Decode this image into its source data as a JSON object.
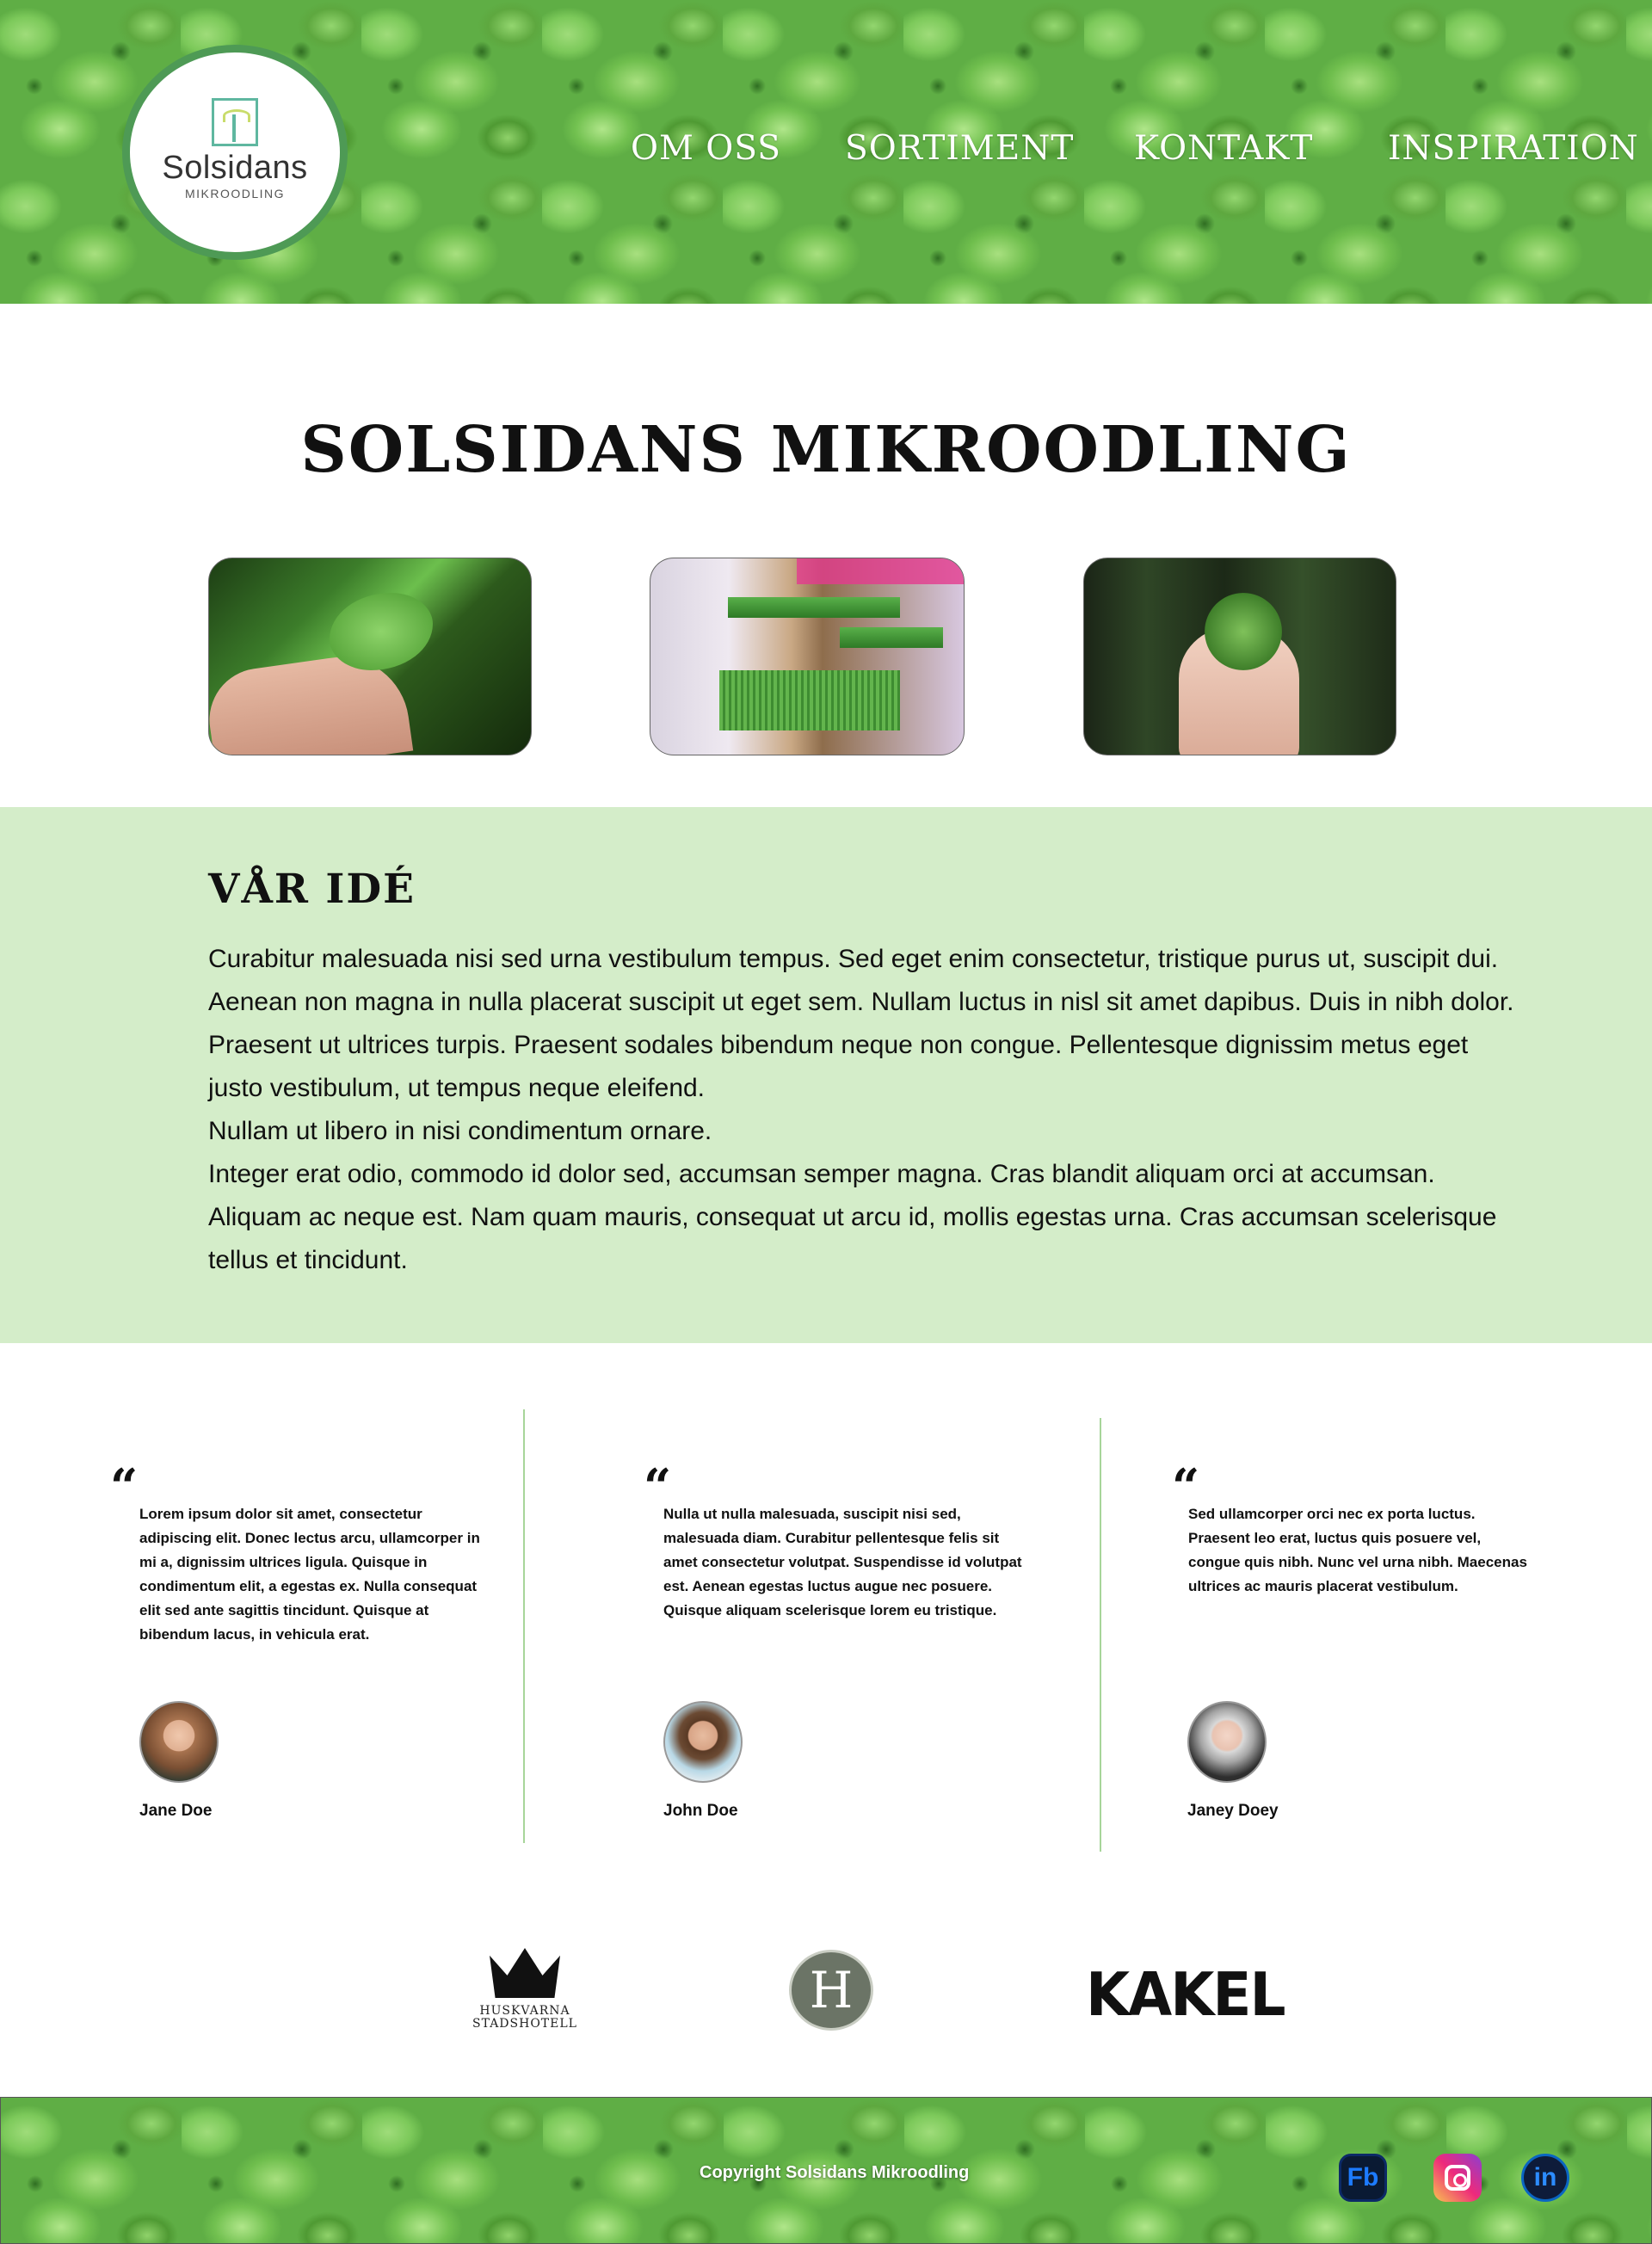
{
  "header": {
    "logo": {
      "name": "Solsidans",
      "sub": "MIKROODLING"
    },
    "nav": [
      {
        "label": "OM OSS"
      },
      {
        "label": "SORTIMENT"
      },
      {
        "label": "KONTAKT"
      },
      {
        "label": "INSPIRATION"
      }
    ]
  },
  "main": {
    "title": "SOLSIDANS MIKROODLING"
  },
  "idea": {
    "heading": "VÅR IDÉ",
    "paragraphs": [
      "Curabitur malesuada nisi sed urna vestibulum tempus. Sed eget enim consectetur, tristique purus ut, suscipit dui. Aenean non magna in nulla placerat suscipit ut eget sem. Nullam luctus in nisl sit amet dapibus. Duis in nibh dolor. Praesent ut ultrices turpis. Praesent sodales bibendum neque non congue. Pellentesque dignissim metus eget justo vestibulum, ut tempus neque eleifend.",
      "Nullam ut libero in nisi condimentum ornare.",
      "Integer erat odio, commodo id dolor sed, accumsan semper magna. Cras blandit aliquam orci at accumsan. Aliquam ac neque est. Nam quam mauris, consequat ut arcu id, mollis egestas urna. Cras accumsan scelerisque tellus et tincidunt."
    ]
  },
  "testimonials": [
    {
      "quote_mark": "“",
      "text": "Lorem ipsum dolor sit amet, consectetur adipiscing elit. Donec lectus arcu, ullamcorper in mi a, dignissim ultrices ligula. Quisque in condimentum elit, a egestas ex. Nulla consequat elit sed ante sagittis tincidunt. Quisque at bibendum lacus, in vehicula erat.",
      "name": "Jane Doe"
    },
    {
      "quote_mark": "“",
      "text": "Nulla ut nulla malesuada, suscipit nisi sed, malesuada diam. Curabitur pellentesque felis sit amet consectetur volutpat. Suspendisse id volutpat est. Aenean egestas luctus augue nec posuere. Quisque aliquam scelerisque lorem eu tristique.",
      "name": "John Doe"
    },
    {
      "quote_mark": "“",
      "text": "Sed ullamcorper orci nec ex porta luctus. Praesent leo erat, luctus quis posuere vel, congue quis nibh. Nunc vel urna nibh. Maecenas ultrices ac mauris placerat vestibulum.",
      "name": "Janey Doey"
    }
  ],
  "partners": {
    "huskvarna": "HUSKVARNA STADSHOTELL",
    "h_letter": "H",
    "kakel": "KAKEL"
  },
  "footer": {
    "copyright": "Copyright Solsidans Mikroodling",
    "social": {
      "fb": "Fb",
      "li": "in"
    }
  },
  "colors": {
    "accent_green": "#4e9a55",
    "idea_bg": "#d4edc9",
    "divider": "#a7d59a"
  }
}
